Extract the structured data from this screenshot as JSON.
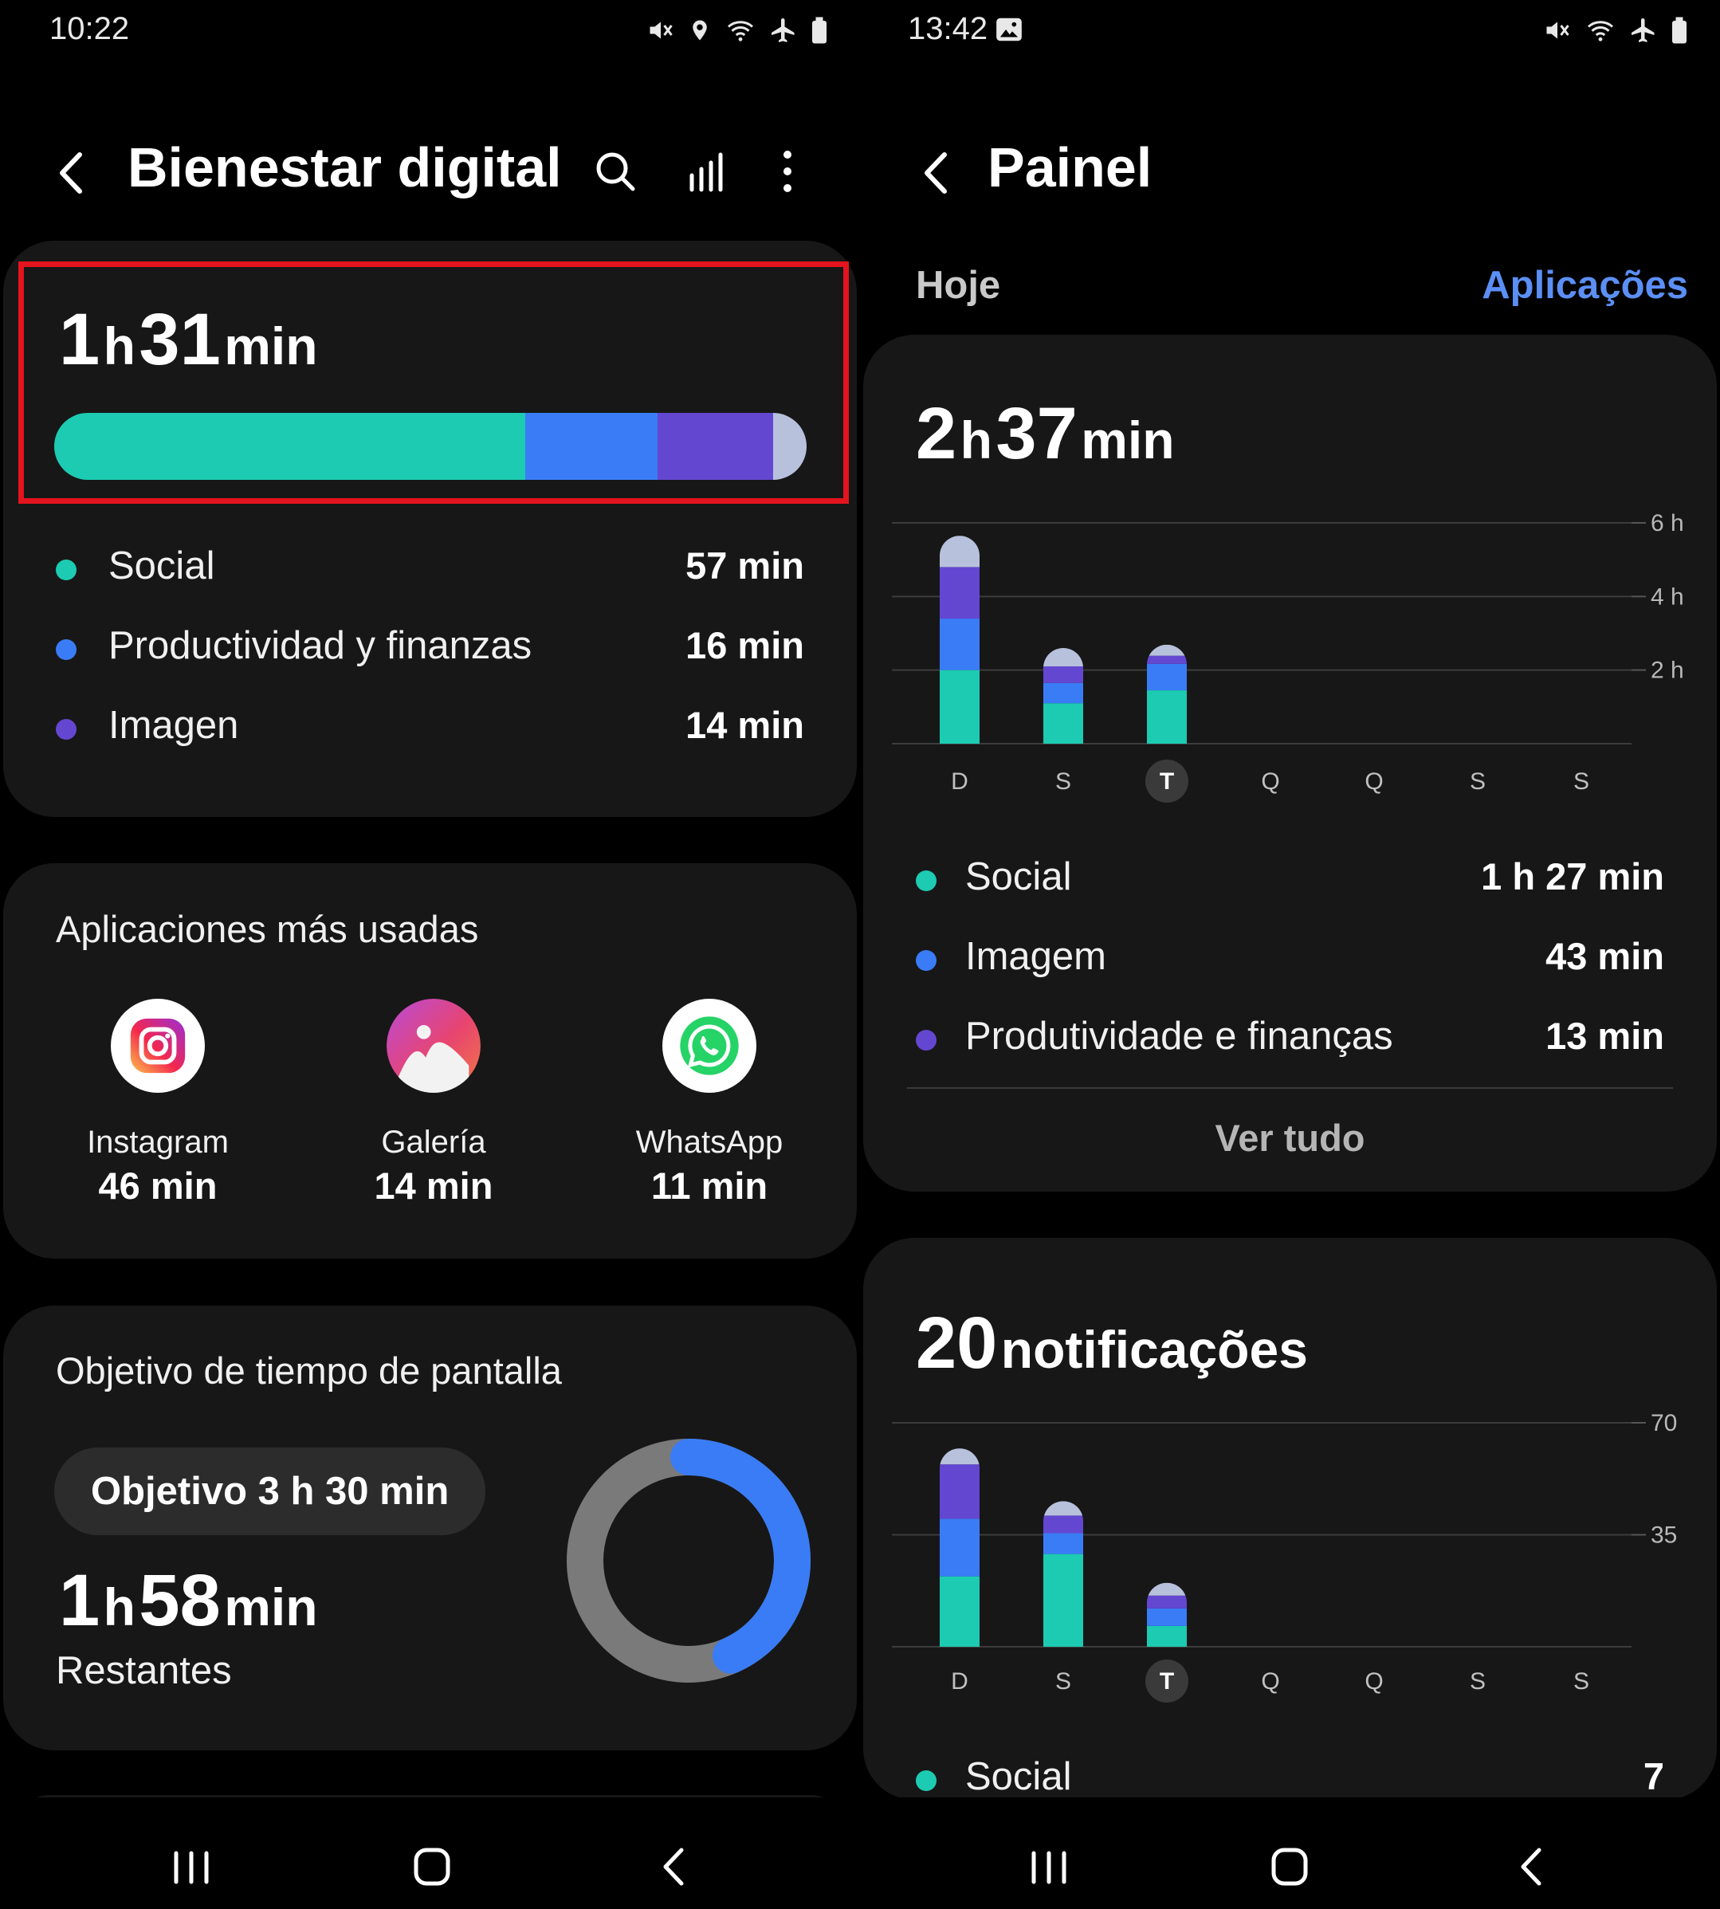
{
  "left": {
    "status": {
      "time": "10:22"
    },
    "header": {
      "title": "Bienestar digital"
    },
    "total": {
      "hours": "1",
      "h_unit": "h",
      "minutes": "31",
      "m_unit": "min"
    },
    "usage_bar": [
      {
        "name": "Social",
        "minutes": 57,
        "color": "#1ccbb2"
      },
      {
        "name": "Productividad y finanzas",
        "minutes": 16,
        "color": "#3a7cf6"
      },
      {
        "name": "Imagen",
        "minutes": 14,
        "color": "#6447d1"
      },
      {
        "name": "other",
        "minutes": 4,
        "color": "#b7c1dc"
      }
    ],
    "categories": [
      {
        "label": "Social",
        "value": "57 min",
        "color": "#1ccbb2"
      },
      {
        "label": "Productividad y finanzas",
        "value": "16 min",
        "color": "#3a7cf6"
      },
      {
        "label": "Imagen",
        "value": "14 min",
        "color": "#6447d1"
      }
    ],
    "apps": {
      "title": "Aplicaciones más usadas",
      "items": [
        {
          "name": "Instagram",
          "time": "46 min",
          "icon": "instagram-icon"
        },
        {
          "name": "Galería",
          "time": "14 min",
          "icon": "gallery-icon"
        },
        {
          "name": "WhatsApp",
          "time": "11 min",
          "icon": "whatsapp-icon"
        }
      ]
    },
    "goal": {
      "title": "Objetivo de tiempo de pantalla",
      "pill": "Objetivo 3 h 30 min",
      "remaining_hours": "1",
      "h_unit": "h",
      "remaining_minutes": "58",
      "m_unit": "min",
      "remaining_label": "Restantes",
      "used_fraction": 0.433,
      "color_used": "#3a7cf6",
      "color_track": "#7a7a7a"
    }
  },
  "right": {
    "status": {
      "time": "13:42"
    },
    "header": {
      "title": "Painel"
    },
    "today_label": "Hoje",
    "apps_link": "Aplicações",
    "usage": {
      "hours": "2",
      "h_unit": "h",
      "minutes": "37",
      "m_unit": "min",
      "categories": [
        {
          "label": "Social",
          "value": "1 h 27 min",
          "color": "#1ccbb2"
        },
        {
          "label": "Imagem",
          "value": "43 min",
          "color": "#3a7cf6"
        },
        {
          "label": "Produtividade e finanças",
          "value": "13 min",
          "color": "#6447d1"
        }
      ],
      "see_all": "Ver tudo"
    },
    "notifications": {
      "count": "20",
      "label": "notificações",
      "first_category": {
        "label": "Social",
        "value": "7",
        "color": "#1ccbb2"
      }
    }
  },
  "chart_data": [
    {
      "type": "bar",
      "stacked": true,
      "categories": [
        "D",
        "S",
        "T",
        "Q",
        "Q",
        "S",
        "S"
      ],
      "highlight": "T",
      "y_ticks": [
        "2 h",
        "4 h",
        "6 h"
      ],
      "ylim": [
        0,
        6
      ],
      "series": [
        {
          "values": [
            2.0,
            1.1,
            1.45,
            0,
            0,
            0,
            0
          ],
          "color": "#1ccbb2"
        },
        {
          "values": [
            1.4,
            0.55,
            0.72,
            0,
            0,
            0,
            0
          ],
          "color": "#3a7cf6"
        },
        {
          "values": [
            1.4,
            0.45,
            0.22,
            0,
            0,
            0,
            0
          ],
          "color": "#6447d1"
        },
        {
          "values": [
            0.85,
            0.5,
            0.3,
            0,
            0,
            0,
            0
          ],
          "color": "#b7c1dc"
        }
      ]
    },
    {
      "type": "bar",
      "stacked": true,
      "categories": [
        "D",
        "S",
        "T",
        "Q",
        "Q",
        "S",
        "S"
      ],
      "highlight": "T",
      "y_ticks": [
        "35",
        "70"
      ],
      "ylim": [
        0,
        70
      ],
      "series": [
        {
          "values": [
            22,
            29,
            6.5,
            0,
            0,
            0,
            0
          ],
          "color": "#1ccbb2"
        },
        {
          "values": [
            18,
            6.5,
            5.5,
            0,
            0,
            0,
            0
          ],
          "color": "#3a7cf6"
        },
        {
          "values": [
            17,
            5.5,
            4,
            0,
            0,
            0,
            0
          ],
          "color": "#6447d1"
        },
        {
          "values": [
            5,
            4.5,
            4,
            0,
            0,
            0,
            0
          ],
          "color": "#b7c1dc"
        }
      ]
    }
  ]
}
